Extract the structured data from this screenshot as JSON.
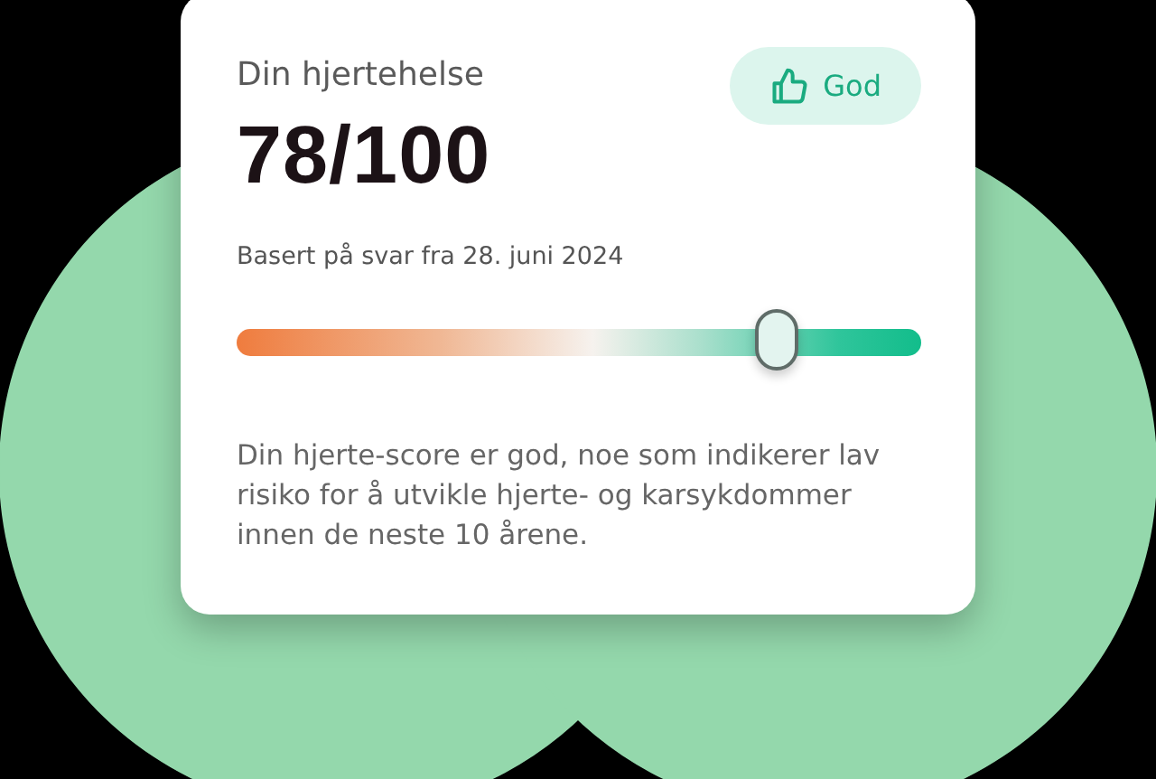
{
  "card": {
    "title": "Din hjertehelse",
    "score": "78/100",
    "badge": {
      "label": "God"
    },
    "basis": "Basert på svar fra 28. juni 2024",
    "meter": {
      "level": 0.79
    },
    "description": "Din hjerte-score er god, noe som indikerer lav risiko for å utvikle hjerte- og karsykdommer innen de neste 10 årene."
  }
}
